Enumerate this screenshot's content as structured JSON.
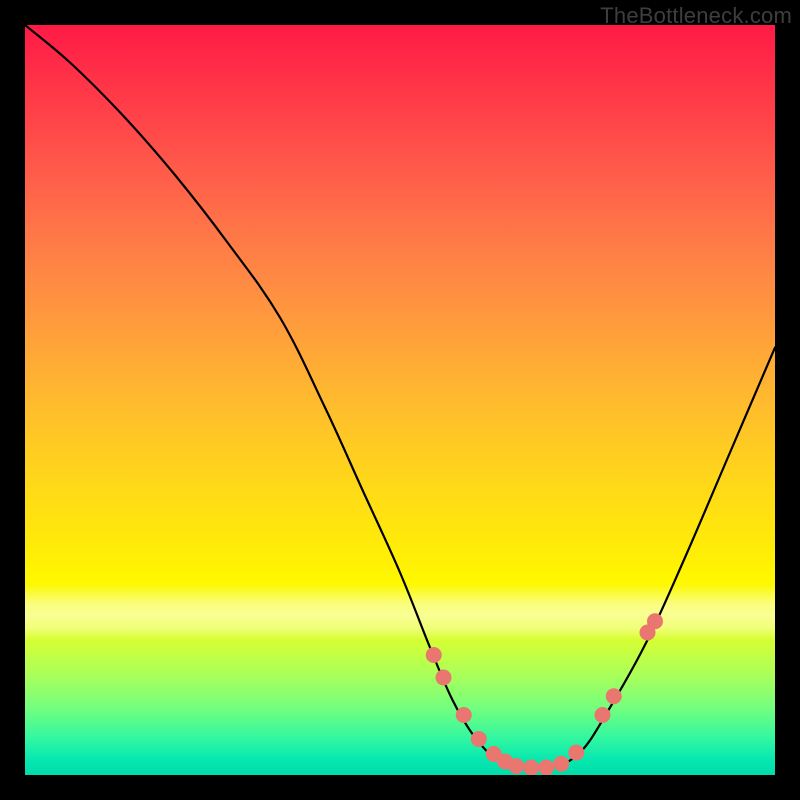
{
  "watermark": "TheBottleneck.com",
  "colors": {
    "curve_stroke": "#000000",
    "dot_fill": "#e9766f",
    "frame_bg": "#000000"
  },
  "chart_data": {
    "type": "line",
    "title": "",
    "xlabel": "",
    "ylabel": "",
    "xlim": [
      0,
      100
    ],
    "ylim": [
      0,
      100
    ],
    "series": [
      {
        "name": "bottleneck-curve",
        "x": [
          0,
          6,
          13,
          20,
          27,
          34,
          40,
          45,
          50,
          54,
          57,
          60,
          63,
          66,
          70,
          74,
          78,
          83,
          88,
          94,
          100
        ],
        "values": [
          100,
          95,
          88,
          80,
          71,
          61,
          49,
          38,
          27,
          17,
          10,
          5,
          2,
          1,
          1,
          3,
          9,
          18,
          29,
          43,
          57
        ]
      }
    ],
    "dots": {
      "name": "highlight-dots",
      "x": [
        54.5,
        55.8,
        58.5,
        60.5,
        62.5,
        64.0,
        65.5,
        67.5,
        69.5,
        71.5,
        73.5,
        77.0,
        78.5,
        83.0,
        84.0
      ],
      "values": [
        16.0,
        13.0,
        8.0,
        4.8,
        2.8,
        1.8,
        1.2,
        1.0,
        1.0,
        1.5,
        3.0,
        8.0,
        10.5,
        19.0,
        20.5
      ]
    }
  }
}
